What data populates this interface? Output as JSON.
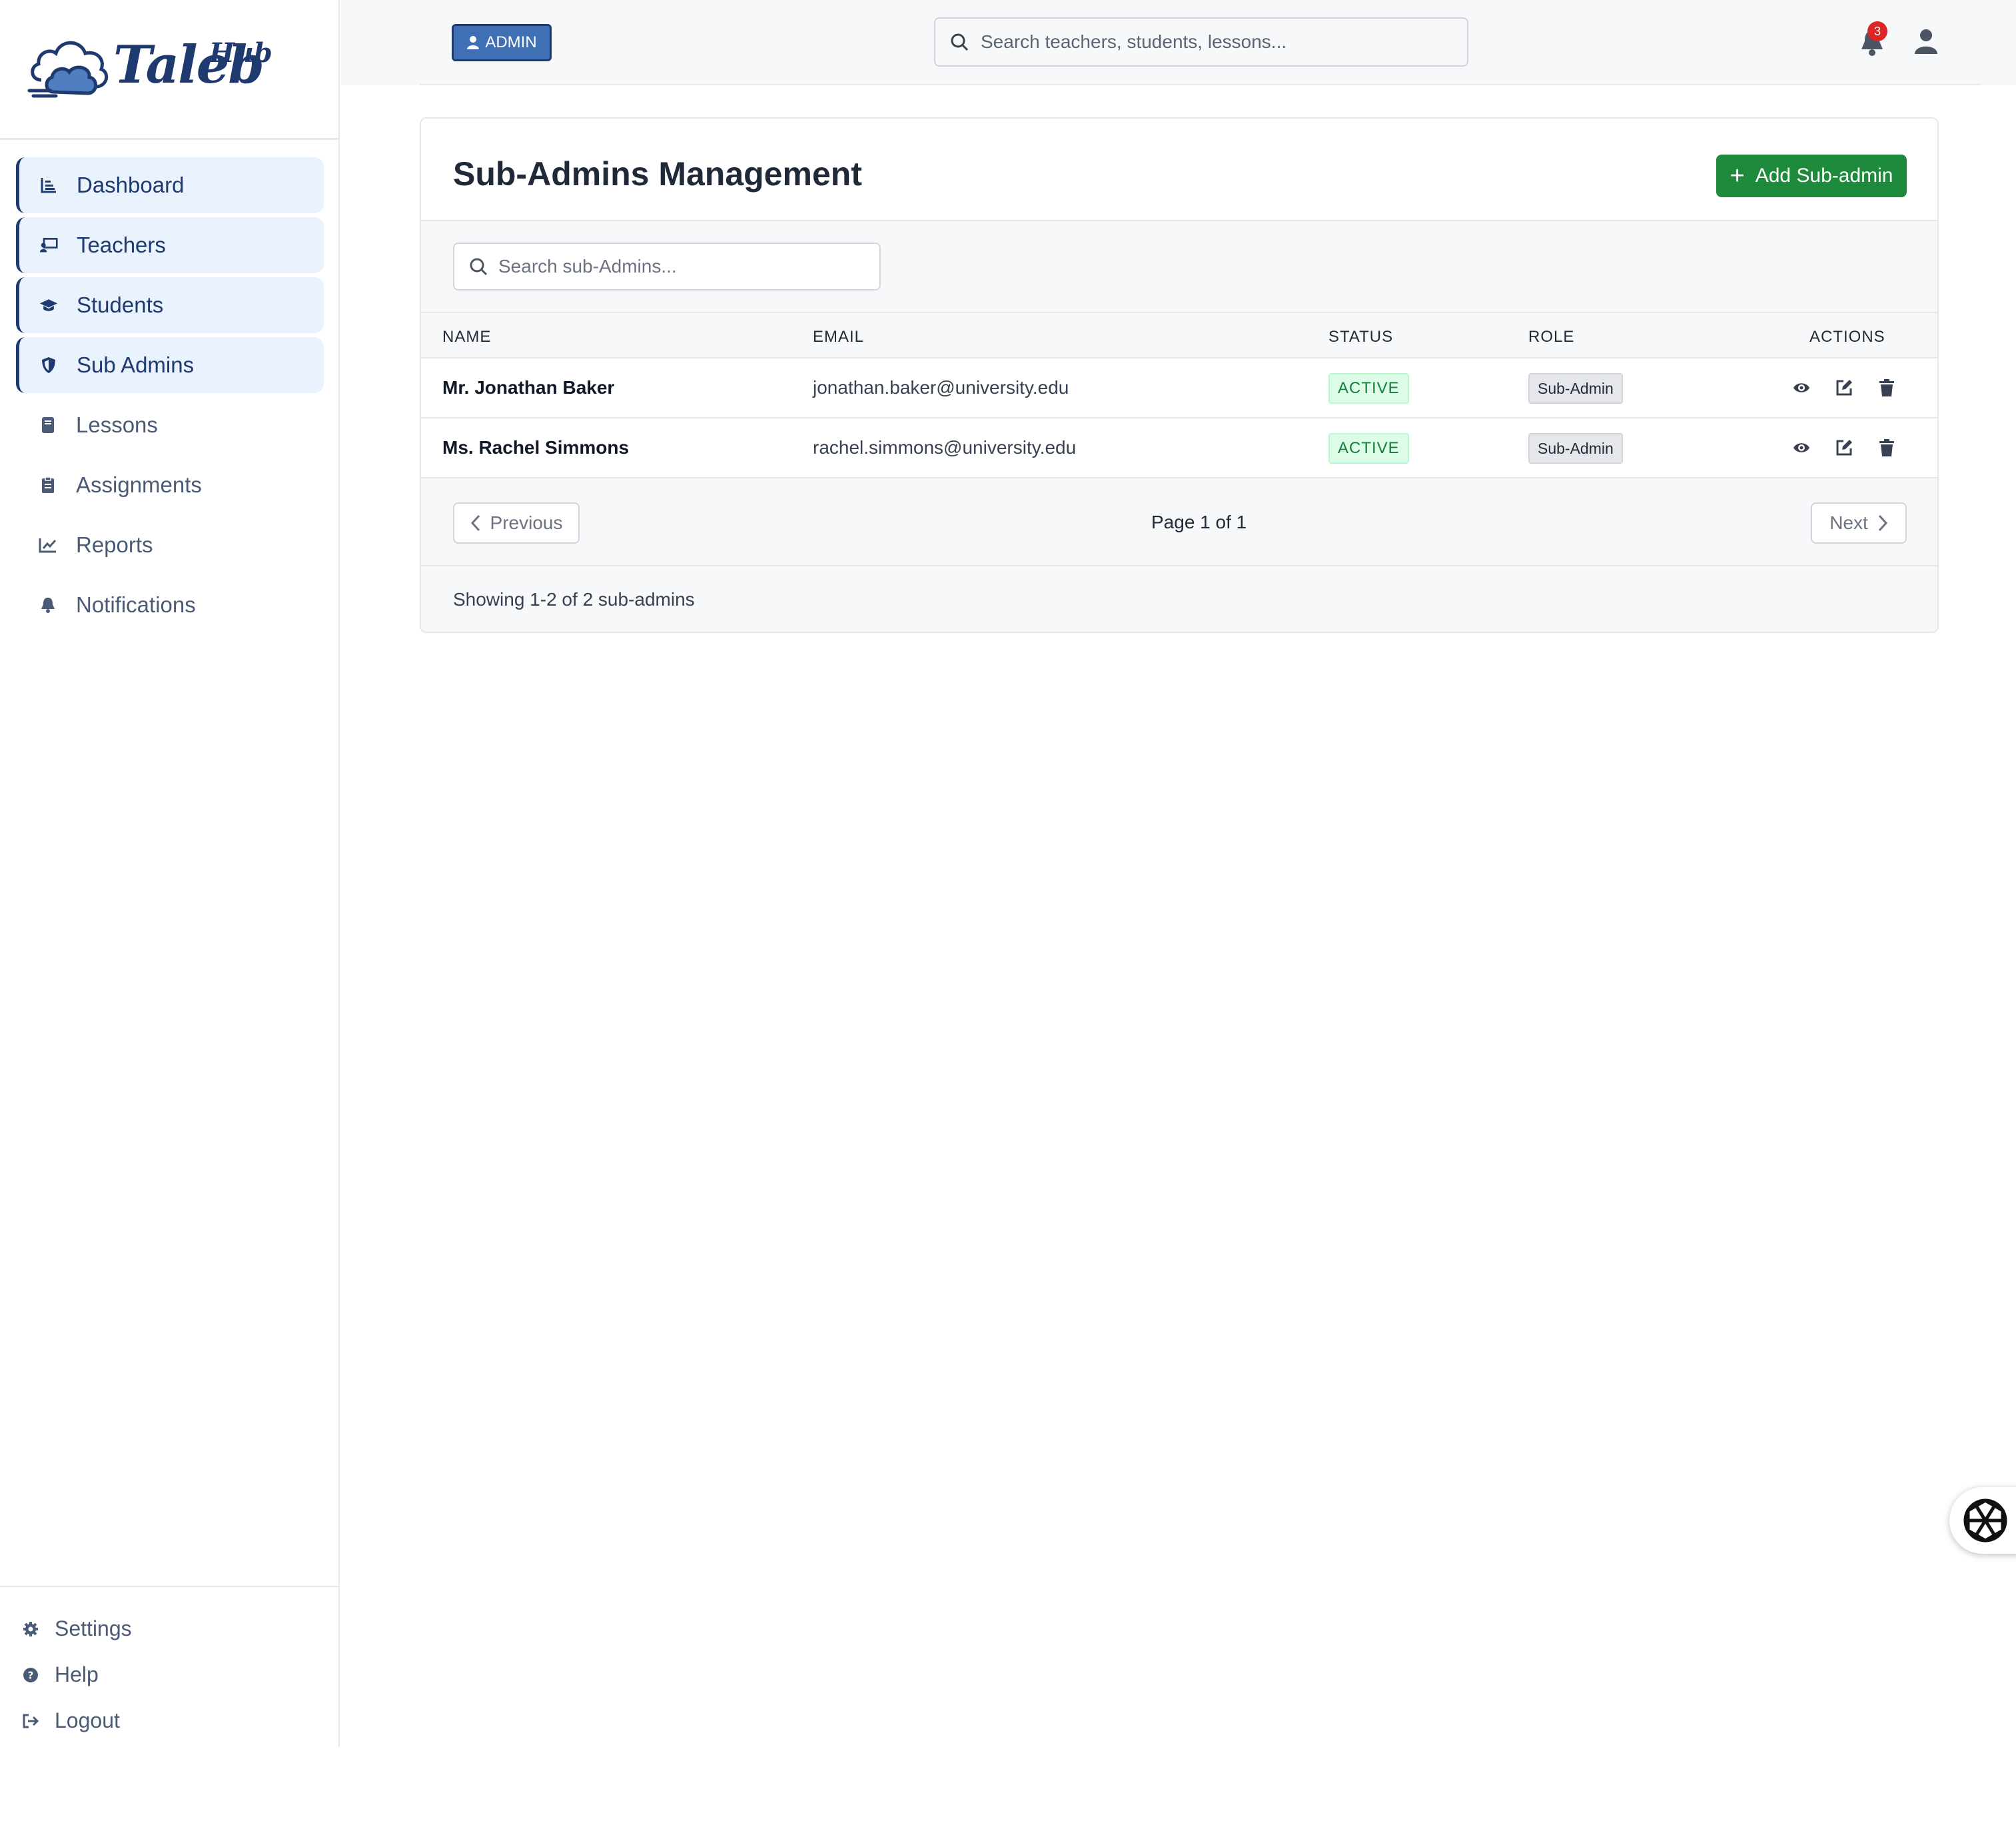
{
  "brand": {
    "name": "Taleb",
    "superscript": "Hub"
  },
  "sidebar": {
    "items": [
      {
        "label": "Dashboard",
        "icon": "chart-bar-icon",
        "active": true
      },
      {
        "label": "Teachers",
        "icon": "chalkboard-teacher-icon",
        "active": true
      },
      {
        "label": "Students",
        "icon": "graduation-cap-icon",
        "active": true
      },
      {
        "label": "Sub Admins",
        "icon": "shield-icon",
        "active": true
      },
      {
        "label": "Lessons",
        "icon": "book-icon",
        "active": false
      },
      {
        "label": "Assignments",
        "icon": "clipboard-icon",
        "active": false
      },
      {
        "label": "Reports",
        "icon": "line-chart-icon",
        "active": false
      },
      {
        "label": "Notifications",
        "icon": "bell-icon",
        "active": false
      }
    ],
    "bottom": [
      {
        "label": "Settings",
        "icon": "gear-icon"
      },
      {
        "label": "Help",
        "icon": "question-circle-icon"
      },
      {
        "label": "Logout",
        "icon": "logout-icon"
      }
    ]
  },
  "header": {
    "role_badge": "ADMIN",
    "search_placeholder": "Search teachers, students, lessons...",
    "notification_count": "3"
  },
  "page": {
    "title": "Sub-Admins Management",
    "add_button": "Add Sub-admin",
    "search_placeholder": "Search sub-Admins...",
    "columns": [
      "NAME",
      "EMAIL",
      "STATUS",
      "ROLE",
      "ACTIONS"
    ],
    "rows": [
      {
        "name": "Mr. Jonathan Baker",
        "email": "jonathan.baker@university.edu",
        "status": "ACTIVE",
        "role": "Sub-Admin"
      },
      {
        "name": "Ms. Rachel Simmons",
        "email": "rachel.simmons@university.edu",
        "status": "ACTIVE",
        "role": "Sub-Admin"
      }
    ],
    "pagination": {
      "previous": "Previous",
      "next": "Next",
      "info": "Page 1 of 1"
    },
    "footer": "Showing 1-2 of 2 sub-admins"
  },
  "colors": {
    "primary": "#1e3a6e",
    "active_nav_bg": "#eaf3fd",
    "success": "#1e8a3c",
    "status_bg": "#dcfce7",
    "badge_red": "#dc2626"
  }
}
